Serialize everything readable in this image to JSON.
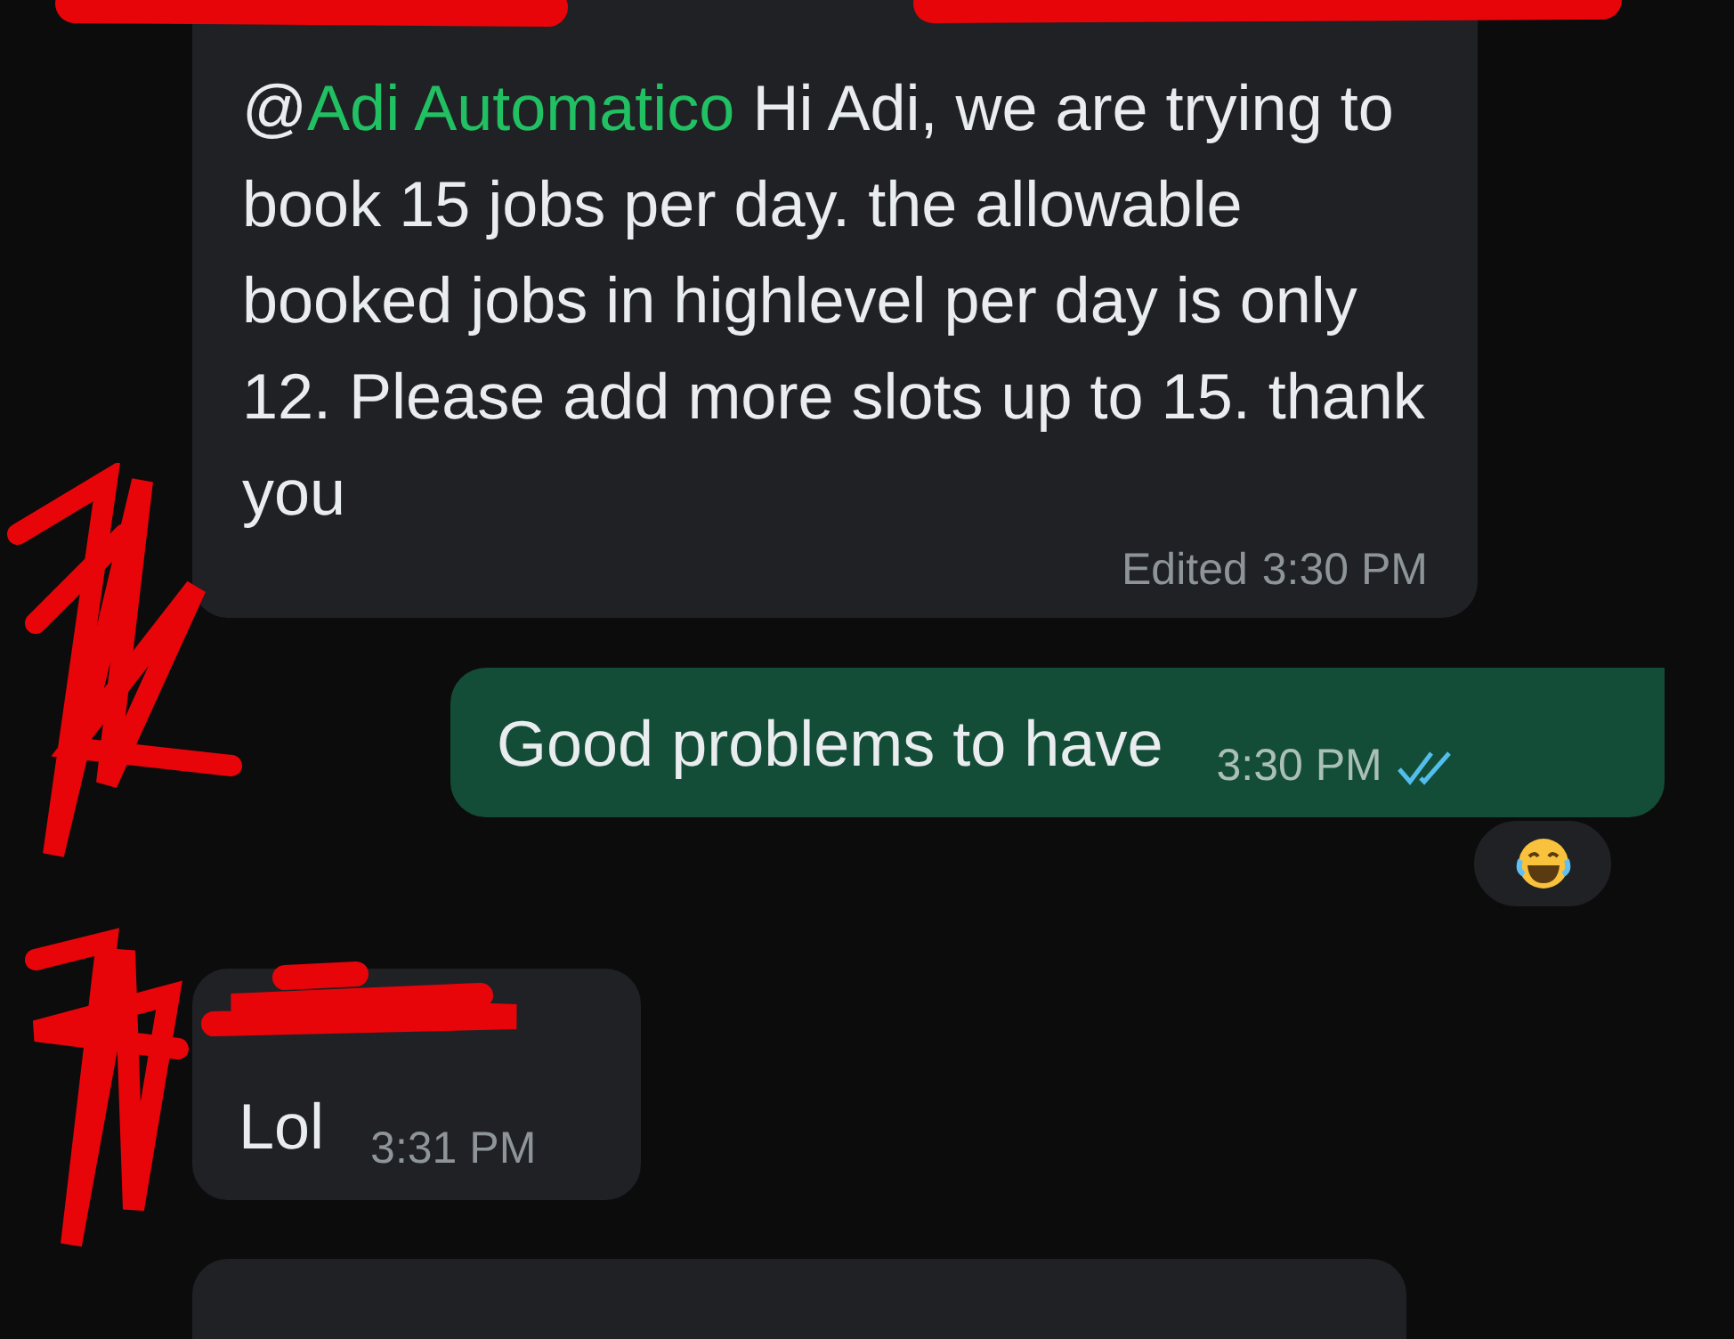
{
  "messages": [
    {
      "kind": "incoming",
      "mention": "@",
      "mention_name": "Adi Automatico",
      "text": "Hi Adi, we are trying to book 15 jobs per day. the allowable booked jobs in highlevel per day is only 12. Please add more slots up to 15. thank you",
      "edited": "Edited",
      "time": "3:30 PM",
      "redacted_sender": true
    },
    {
      "kind": "outgoing",
      "text": "Good problems to have",
      "time": "3:30 PM",
      "read": true,
      "laugh_reaction": true
    },
    {
      "kind": "incoming",
      "text": "Lol",
      "time": "3:31 PM",
      "redacted_sender": true
    },
    {
      "kind": "incoming_cut"
    }
  ]
}
